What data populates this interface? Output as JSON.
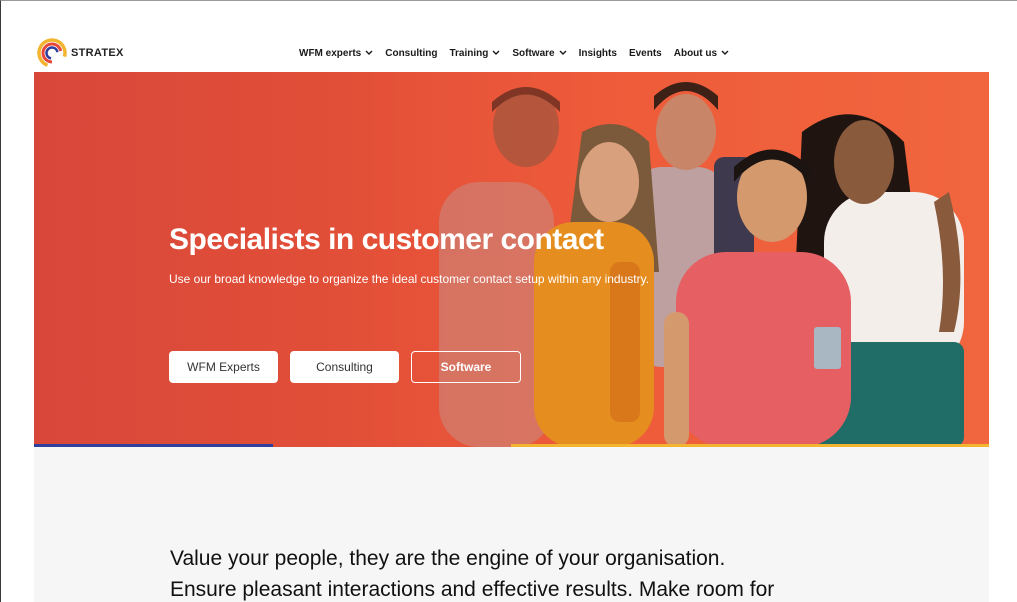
{
  "brand": {
    "name": "STRATEX",
    "logo_colors": [
      "#f3b52f",
      "#e8483a",
      "#2f3f9c"
    ]
  },
  "nav": {
    "items": [
      {
        "label": "WFM experts",
        "dropdown": true
      },
      {
        "label": "Consulting",
        "dropdown": false
      },
      {
        "label": "Training",
        "dropdown": true
      },
      {
        "label": "Software",
        "dropdown": true
      },
      {
        "label": "Insights",
        "dropdown": false
      },
      {
        "label": "Events",
        "dropdown": false
      },
      {
        "label": "About us",
        "dropdown": true
      }
    ]
  },
  "hero": {
    "title": "Specialists in customer contact",
    "subtitle": "Use our broad knowledge to organize the ideal customer contact setup within any industry.",
    "buttons": {
      "wfm": "WFM Experts",
      "consulting": "Consulting",
      "software": "Software"
    },
    "background_color": "#e8503a"
  },
  "intro": {
    "line1": "Value your people, they are the engine of your organisation.",
    "line2": "Ensure pleasant interactions and effective results. Make room for"
  },
  "colors": {
    "accent_blue": "#2f3f9c",
    "accent_yellow": "#f3b52f",
    "content_bg": "#f6f6f6"
  }
}
